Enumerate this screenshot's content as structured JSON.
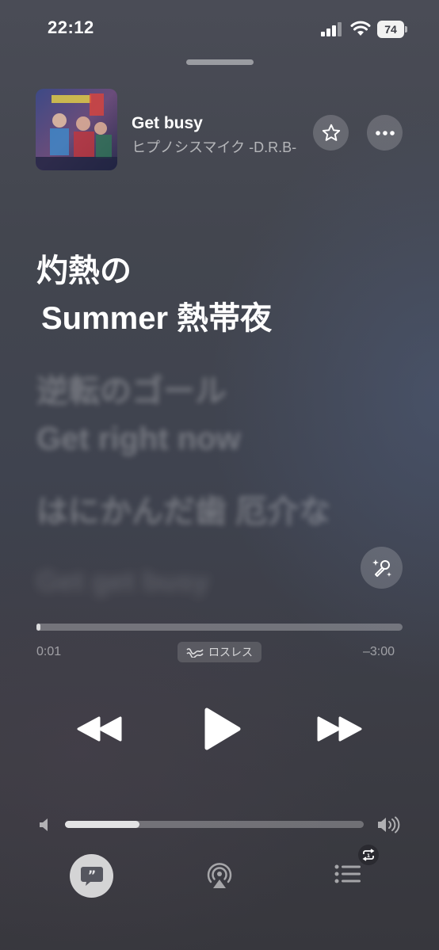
{
  "status_bar": {
    "time": "22:12",
    "battery": "74"
  },
  "now_playing": {
    "title": "Get busy",
    "artist": "ヒプノシスマイク -D.R.B-"
  },
  "lyrics": {
    "current": [
      "灼熱の",
      "Summer 熱帯夜"
    ],
    "upcoming": [
      "逆転のゴール",
      "Get right now",
      "はにかんだ歯 厄介な",
      "Get get busy"
    ]
  },
  "playback": {
    "elapsed": "0:01",
    "remaining": "–3:00",
    "progress_fraction": 0.004,
    "quality_label": "ロスレス"
  },
  "volume": {
    "level_fraction": 0.25
  },
  "icons": {
    "favorite": "star-icon",
    "more": "ellipsis-icon",
    "sing": "microphone-sparkle-icon",
    "lossless": "waveform-icon",
    "rewind": "backward-icon",
    "play": "play-icon",
    "forward": "forward-icon",
    "lyrics": "quote-bubble-icon",
    "airplay": "airplay-icon",
    "queue": "list-icon",
    "repeat": "repeat-one-icon"
  }
}
